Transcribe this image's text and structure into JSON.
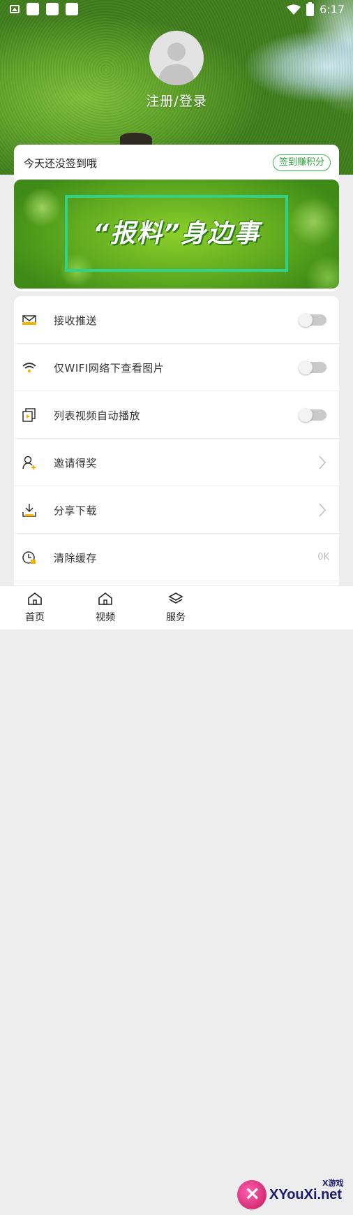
{
  "status_bar": {
    "time": "6:17"
  },
  "profile": {
    "login_label": "注册/登录"
  },
  "sign_in": {
    "message": "今天还没签到哦",
    "button_label": "签到赚积分"
  },
  "banner": {
    "text": "“报料”身边事"
  },
  "settings": {
    "items": [
      {
        "label": "接收推送",
        "control": "toggle",
        "icon": "push-icon",
        "on": false
      },
      {
        "label": "仅WIFI网络下查看图片",
        "control": "toggle",
        "icon": "wifi-icon",
        "on": false
      },
      {
        "label": "列表视频自动播放",
        "control": "toggle",
        "icon": "video-autoplay-icon",
        "on": false
      },
      {
        "label": "邀请得奖",
        "control": "chevron",
        "icon": "invite-user-icon"
      },
      {
        "label": "分享下载",
        "control": "chevron",
        "icon": "download-icon"
      },
      {
        "label": "清除缓存",
        "control": "value",
        "value": "0K",
        "icon": "clear-cache-icon"
      }
    ]
  },
  "bottom_nav": {
    "items": [
      {
        "label": "首页",
        "icon": "home-icon"
      },
      {
        "label": "视频",
        "icon": "video-home-icon"
      },
      {
        "label": "服务",
        "icon": "layers-icon"
      }
    ]
  },
  "watermark": {
    "brand": "XYouXi.net",
    "sub": "X游戏"
  }
}
